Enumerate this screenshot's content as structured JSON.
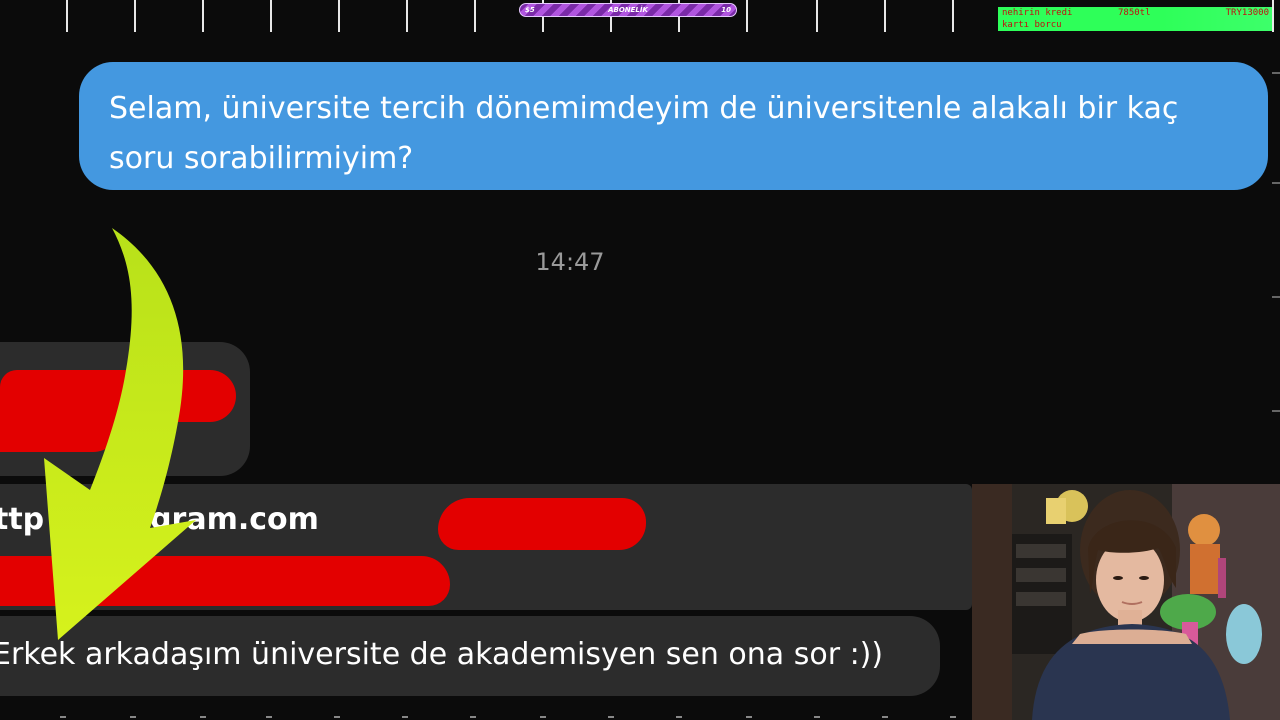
{
  "stream_overlay": {
    "goal_bar": {
      "min": "$5",
      "title": "ABONELİK",
      "max": "10"
    },
    "credit_card": {
      "label": "nehirin kredi",
      "value": "7850tl",
      "total": "TRY13000",
      "sub_label": "kartı borcu"
    }
  },
  "chat": {
    "outgoing_message": "Selam, üniversite tercih dönemimdeyim de üniversitenle alakalı bir kaç soru sorabilirmiyim?",
    "timestamp": "14:47",
    "link_message": "ttp .instagram.com",
    "reply_message": "Erkek arkadaşım üniversite de akademisyen sen ona sor :))"
  },
  "colors": {
    "outgoing_bubble": "#4498e0",
    "incoming_bubble": "#2c2c2c",
    "background": "#0b0b0b",
    "redaction": "#e30000",
    "arrow": "#c8ea1e"
  }
}
